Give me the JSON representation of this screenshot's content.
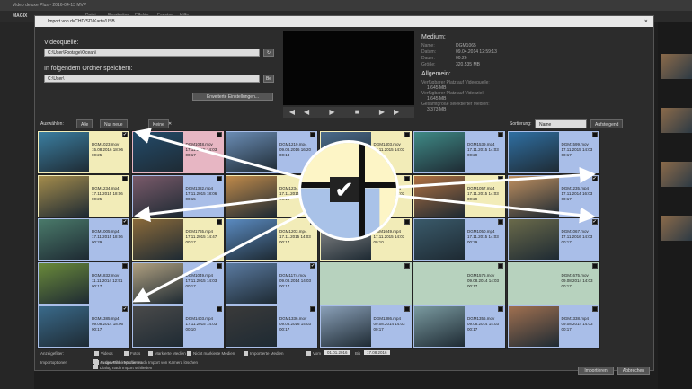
{
  "app": {
    "title": "Video deluxe Plus - 2016-04-13 MVP",
    "logo": "MAGIX",
    "menu": [
      "Datei",
      "Bearbeiten",
      "Effekte",
      "Fenster",
      "Hilfe"
    ]
  },
  "dialog": {
    "title": "Import von dvCHD/SD-Karte/USB",
    "source_label": "Videoquelle:",
    "source_value": "C:\\User\\Footage\\Ocean\\",
    "target_label": "In folgendem Ordner speichern:",
    "target_value": "C:\\User\\",
    "browse": "Be",
    "advanced": "Erweiterte Einstellungen..."
  },
  "media": {
    "heading": "Medium:",
    "rows": [
      [
        "Name:",
        "DGM1065"
      ],
      [
        "Datum:",
        "09.04.2014 12:59:13"
      ],
      [
        "Dauer:",
        "00:26"
      ],
      [
        "Größe:",
        "320,535 MB"
      ]
    ],
    "general_heading": "Allgemein:",
    "general": [
      [
        "Verfügbarer Platz auf Videoquelle:",
        "1,645 MB"
      ],
      [
        "Verfügbarer Platz auf Videoziel:",
        "1,645 MB"
      ],
      [
        "Gesamtgröße selektierter Medien:",
        "3,373 MB"
      ]
    ]
  },
  "toolbar": {
    "select_label": "Auswählen:",
    "all": "Alle",
    "only_new": "Nur neue",
    "none": "Keine",
    "clear": "✕",
    "sort_label": "Sortierung:",
    "sort_value": "Name",
    "order": "Aufsteigend"
  },
  "clips": [
    {
      "name": "DGM1023.mov",
      "date": "15.08.2016 18:06",
      "dur": "00:25",
      "checked": true,
      "bg": "#f2ecb8",
      "img": "#3b7ea0"
    },
    {
      "name": "DGM1048.mov",
      "date": "17.11.2015 14:03",
      "dur": "00:17",
      "checked": false,
      "bg": "#e7b6c3",
      "img": "#234b6a"
    },
    {
      "name": "DGM1219.mp4",
      "date": "09.08.2016 16:20",
      "dur": "00:13",
      "checked": false,
      "bg": "#a9bee8",
      "img": "#6a8cb4"
    },
    {
      "name": "DGM1403.mov",
      "date": "17.11.2015 14:03",
      "dur": "00:10",
      "checked": false,
      "bg": "#f2ecb8",
      "img": "#4b6b8a"
    },
    {
      "name": "DGM1539.mp4",
      "date": "17.11.2015 14:03",
      "dur": "00:29",
      "checked": false,
      "bg": "#a9bee8",
      "img": "#3f8a86"
    },
    {
      "name": "DGM1599.mov",
      "date": "17.11.2015 14:03",
      "dur": "00:17",
      "checked": false,
      "bg": "#a9bee8",
      "img": "#2f6fa2"
    },
    {
      "name": "DGM1234.mp4",
      "date": "17.11.2015 18:06",
      "dur": "00:25",
      "checked": false,
      "bg": "#f2ecb8",
      "img": "#a48c4c"
    },
    {
      "name": "DGM1382.mp4",
      "date": "17.11.2015 18:06",
      "dur": "00:15",
      "checked": false,
      "bg": "#a9bee8",
      "img": "#7a5a6a"
    },
    {
      "name": "DGM1234.mov",
      "date": "17.11.2015 14:03",
      "dur": "00:10",
      "checked": false,
      "bg": "#f2ecb8",
      "img": "#c08a4a"
    },
    {
      "name": "DGM1403.mp4",
      "date": "17.11.2015 14:03",
      "dur": "00:10",
      "checked": false,
      "bg": "#f2ecb8",
      "img": "#707070"
    },
    {
      "name": "DGM1057.mp4",
      "date": "17.11.2015 14:03",
      "dur": "00:29",
      "checked": false,
      "bg": "#f2ecb8",
      "img": "#b07040"
    },
    {
      "name": "DGM1235.mp4",
      "date": "17.11.2014 16:03",
      "dur": "00:17",
      "checked": true,
      "bg": "#a9bee8",
      "img": "#c09060"
    },
    {
      "name": "DGM1005.mp4",
      "date": "17.11.2015 18:06",
      "dur": "00:29",
      "checked": true,
      "bg": "#a9bee8",
      "img": "#4a7a6a"
    },
    {
      "name": "DGM1765.mp4",
      "date": "17.11.2015 14:47",
      "dur": "00:17",
      "checked": false,
      "bg": "#f2ecb8",
      "img": "#8a6a3a"
    },
    {
      "name": "DGM1203.mp4",
      "date": "17.11.2015 14:03",
      "dur": "00:17",
      "checked": false,
      "bg": "#f2ecb8",
      "img": "#5a8ac0"
    },
    {
      "name": "DGM1049.mp4",
      "date": "17.11.2015 14:03",
      "dur": "00:10",
      "checked": false,
      "bg": "#f2ecb8",
      "img": "#909090"
    },
    {
      "name": "DGM1050.mp4",
      "date": "17.11.2015 14:03",
      "dur": "00:29",
      "checked": false,
      "bg": "#a9bee8",
      "img": "#3a5a6a"
    },
    {
      "name": "DGM1067.mov",
      "date": "17.11.2016 14:03",
      "dur": "00:17",
      "checked": true,
      "bg": "#a9bee8",
      "img": "#6a6a4a"
    },
    {
      "name": "DGM1832.mov",
      "date": "11.11.2014 12:51",
      "dur": "00:17",
      "checked": false,
      "bg": "#a9bee8",
      "img": "#6a8a3a"
    },
    {
      "name": "DGM1049.mp4",
      "date": "17.11.2015 14:03",
      "dur": "00:17",
      "checked": false,
      "bg": "#a9bee8",
      "img": "#b0a080"
    },
    {
      "name": "DGM1174.mov",
      "date": "09.08.2014 14:03",
      "dur": "00:17",
      "checked": true,
      "bg": "#a9bee8",
      "img": "#5a7aa0"
    },
    {
      "name": "",
      "date": "",
      "dur": "",
      "checked": false,
      "bg": "#b7d2be",
      "img": "#b7d2be"
    },
    {
      "name": "DGM1575.mov",
      "date": "09.08.2014 14:03",
      "dur": "00:17",
      "checked": false,
      "bg": "#b7d2be",
      "img": "#b7d2be"
    },
    {
      "name": "DGM1675.mov",
      "date": "09.08.2014 14:03",
      "dur": "00:17",
      "checked": false,
      "bg": "#b7d2be",
      "img": "#b7d2be"
    },
    {
      "name": "DGM1385.mp4",
      "date": "09.08.2014 18:06",
      "dur": "00:17",
      "checked": true,
      "bg": "#a9bee8",
      "img": "#3a6a8a"
    },
    {
      "name": "DGM1403.mp4",
      "date": "17.11.2015 14:03",
      "dur": "00:10",
      "checked": false,
      "bg": "#a9bee8",
      "img": "#4a4a4a"
    },
    {
      "name": "DGM1336.mov",
      "date": "09.08.2016 14:03",
      "dur": "00:17",
      "checked": false,
      "bg": "#a9bee8",
      "img": "#3a3a3a"
    },
    {
      "name": "DGM1386.mp4",
      "date": "09.08.2014 14:03",
      "dur": "00:17",
      "checked": false,
      "bg": "#a9bee8",
      "img": "#8aa0b8"
    },
    {
      "name": "DGM1356.mov",
      "date": "09.08.2014 14:03",
      "dur": "00:17",
      "checked": false,
      "bg": "#a9bee8",
      "img": "#7a9aa0"
    },
    {
      "name": "DGM1338.mp4",
      "date": "09.08.2014 14:03",
      "dur": "00:17",
      "checked": false,
      "bg": "#a9bee8",
      "img": "#a07050"
    }
  ],
  "filter": {
    "label": "Anzeigefilter:",
    "opts": [
      "Videos",
      "Fotos",
      "Markierte Medien",
      "Nicht markierte Medien",
      "Importierte Medien"
    ],
    "from_label": "Vom",
    "from": "01.01.2016",
    "to_label": "Bis",
    "to": "17.08.2016",
    "options_label": "Importoptionen",
    "opt1": "In den Film importieren",
    "opt2": "Ausgewählte Medien nach Import von Kamera löschen",
    "opt3": "Dialog nach Import schließen"
  },
  "actions": {
    "import": "Importieren",
    "cancel": "Abbrechen"
  }
}
